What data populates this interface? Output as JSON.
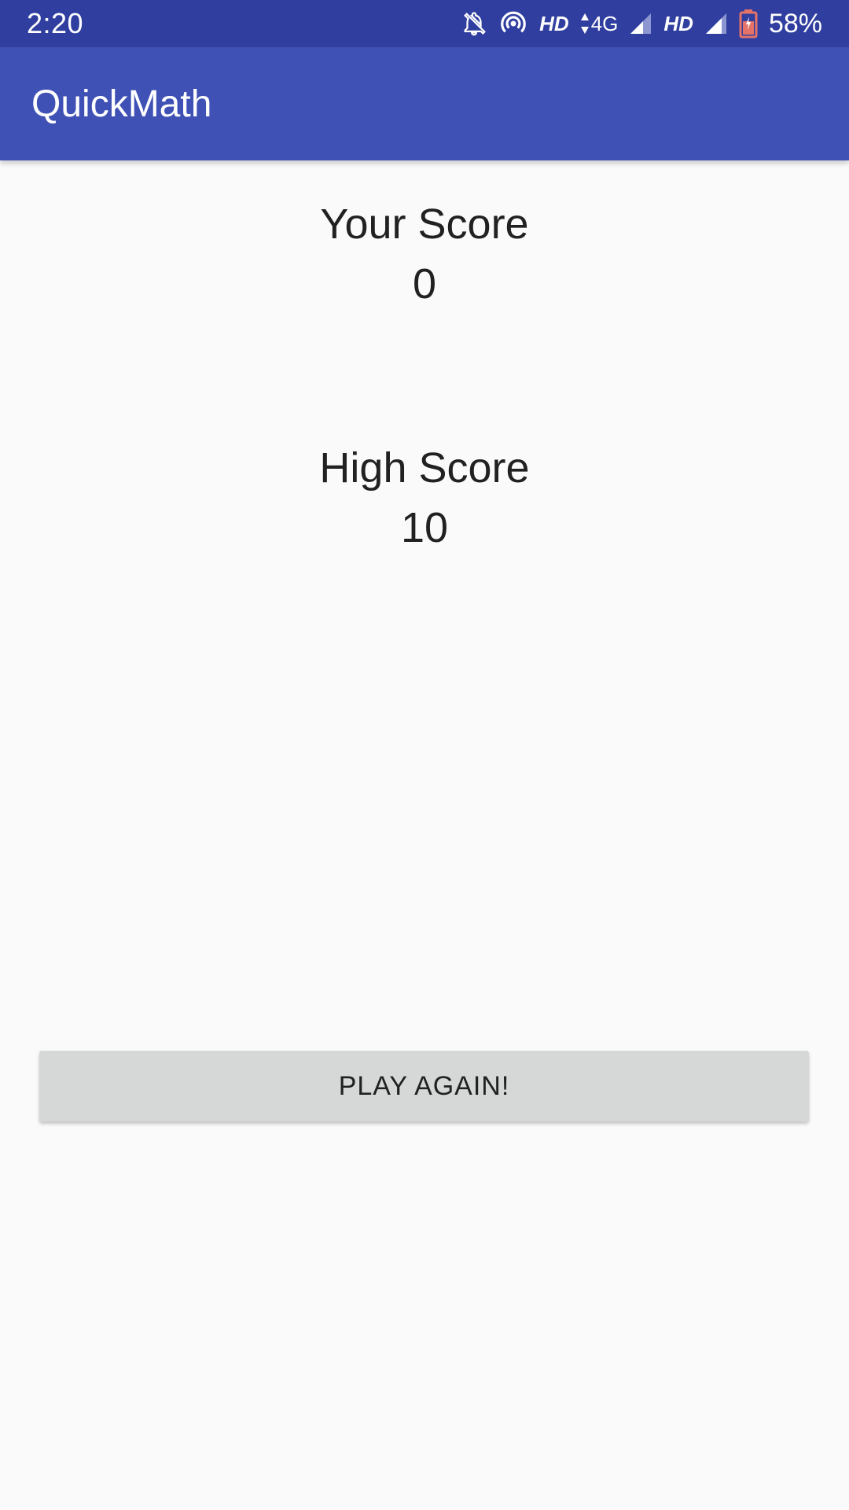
{
  "status_bar": {
    "time": "2:20",
    "network_hd_1": "HD",
    "network_type": "4G",
    "network_hd_2": "HD",
    "battery_percent": "58%",
    "icons": [
      "notifications-off-icon",
      "hotspot-icon",
      "data-arrows-icon",
      "signal-icon",
      "signal-icon",
      "battery-icon"
    ]
  },
  "app_bar": {
    "title": "QuickMath",
    "color": "#3f51b5",
    "status_color": "#303f9f"
  },
  "main": {
    "your_score_label": "Your Score",
    "your_score_value": "0",
    "high_score_label": "High Score",
    "high_score_value": "10",
    "play_again_label": "PLAY AGAIN!"
  }
}
